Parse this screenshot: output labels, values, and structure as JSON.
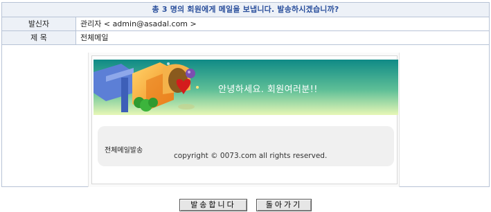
{
  "header": {
    "title": "총 3 명의 회원에게 메일을 보냅니다. 발송하시겠습니까?"
  },
  "fields": {
    "sender_label": "발신자",
    "sender_value": "관리자 < admin@asadal.com >",
    "subject_label": "제 목",
    "subject_value": "전체메일"
  },
  "preview": {
    "banner_greeting": "안녕하세요. 회원여러분!!",
    "body_text": "전체메일발송",
    "copyright": "copyright © 0073.com all rights reserved."
  },
  "buttons": {
    "send_label": "발송합니다",
    "back_label": "돌아가기"
  },
  "colors": {
    "title_text": "#2a4f9c",
    "label_bg": "#edf1f7",
    "border": "#b7c3d6",
    "banner_top": "#0f8a86",
    "banner_bottom": "#e7f7b6"
  }
}
